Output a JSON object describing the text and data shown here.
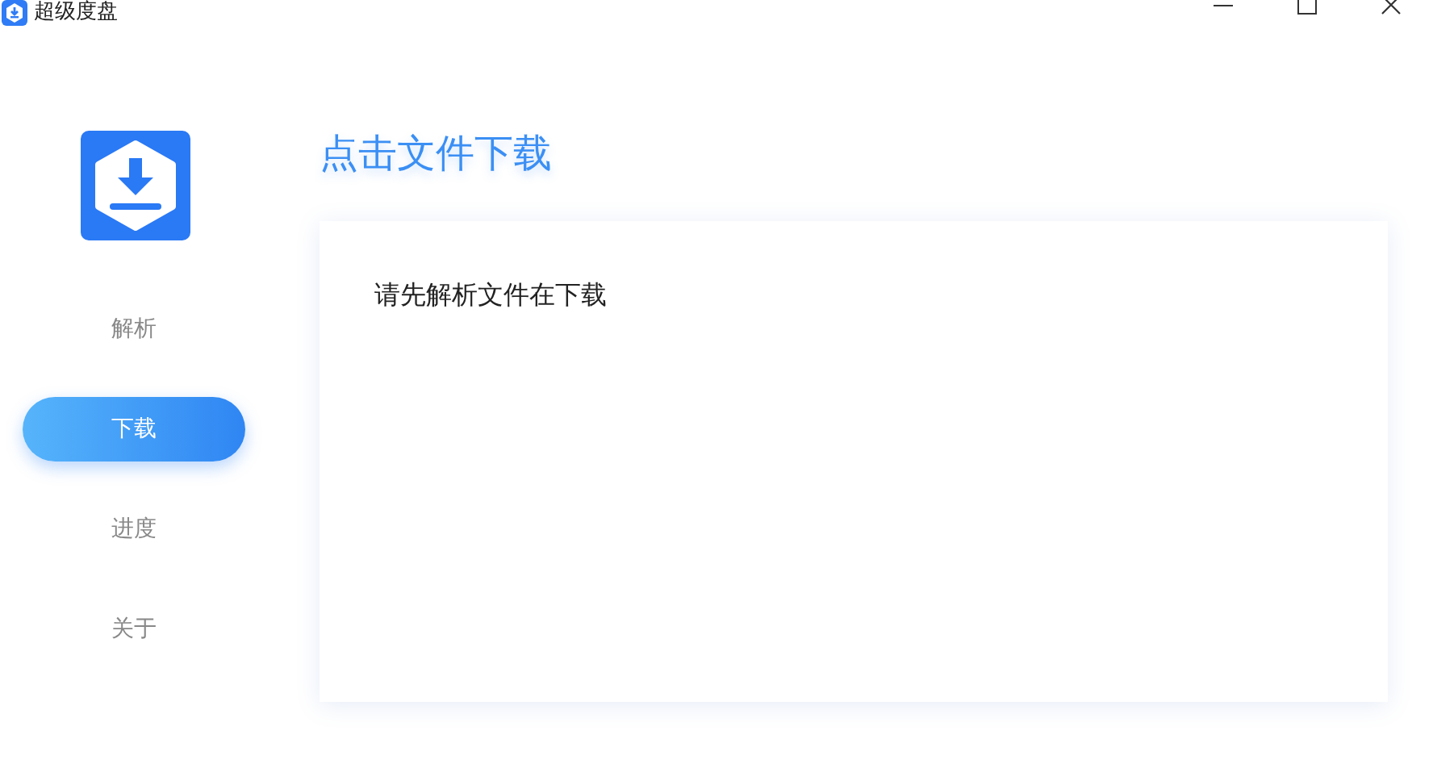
{
  "window": {
    "title": "超级度盘"
  },
  "sidebar": {
    "items": [
      {
        "label": "解析",
        "selected": false
      },
      {
        "label": "下载",
        "selected": true
      },
      {
        "label": "进度",
        "selected": false
      },
      {
        "label": "关于",
        "selected": false
      }
    ]
  },
  "page": {
    "heading": "点击文件下载",
    "message": "请先解析文件在下载"
  }
}
